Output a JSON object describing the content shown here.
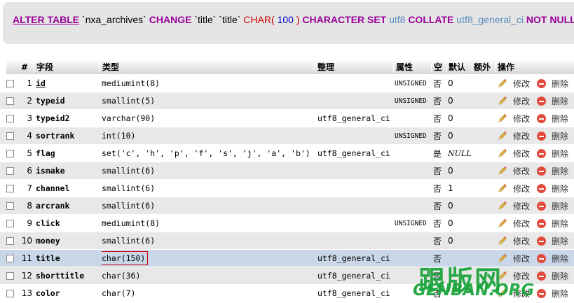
{
  "sql": {
    "alter_table": "ALTER TABLE",
    "table": "`nxa_archives`",
    "change": "CHANGE",
    "old_col": "`title`",
    "new_col": "`title`",
    "char_fn": "CHAR(",
    "length": "100",
    "paren_close": ")",
    "character_set": "CHARACTER SET",
    "charset": "utf8",
    "collate": "COLLATE",
    "collation": "utf8_general_ci",
    "not_null": "NOT NULL"
  },
  "headers": {
    "num": "#",
    "field": "字段",
    "type": "类型",
    "collation": "整理",
    "attributes": "属性",
    "null": "空",
    "default": "默认",
    "extra": "额外",
    "action": "操作"
  },
  "actions": {
    "edit": "修改",
    "delete": "删除"
  },
  "rows": [
    {
      "num": "1",
      "field": "id",
      "type": "mediumint(8)",
      "collation": "",
      "attr": "UNSIGNED",
      "null": "否",
      "default": "0"
    },
    {
      "num": "2",
      "field": "typeid",
      "type": "smallint(5)",
      "collation": "",
      "attr": "UNSIGNED",
      "null": "否",
      "default": "0"
    },
    {
      "num": "3",
      "field": "typeid2",
      "type": "varchar(90)",
      "collation": "utf8_general_ci",
      "attr": "",
      "null": "否",
      "default": "0"
    },
    {
      "num": "4",
      "field": "sortrank",
      "type": "int(10)",
      "collation": "",
      "attr": "UNSIGNED",
      "null": "否",
      "default": "0"
    },
    {
      "num": "5",
      "field": "flag",
      "type": "set('c', 'h', 'p', 'f', 's', 'j', 'a', 'b')",
      "collation": "utf8_general_ci",
      "attr": "",
      "null": "是",
      "default": "NULL"
    },
    {
      "num": "6",
      "field": "ismake",
      "type": "smallint(6)",
      "collation": "",
      "attr": "",
      "null": "否",
      "default": "0"
    },
    {
      "num": "7",
      "field": "channel",
      "type": "smallint(6)",
      "collation": "",
      "attr": "",
      "null": "否",
      "default": "1"
    },
    {
      "num": "8",
      "field": "arcrank",
      "type": "smallint(6)",
      "collation": "",
      "attr": "",
      "null": "否",
      "default": "0"
    },
    {
      "num": "9",
      "field": "click",
      "type": "mediumint(8)",
      "collation": "",
      "attr": "UNSIGNED",
      "null": "否",
      "default": "0"
    },
    {
      "num": "10",
      "field": "money",
      "type": "smallint(6)",
      "collation": "",
      "attr": "",
      "null": "否",
      "default": "0"
    },
    {
      "num": "11",
      "field": "title",
      "type": "char(150)",
      "collation": "utf8_general_ci",
      "attr": "",
      "null": "否",
      "default": ""
    },
    {
      "num": "12",
      "field": "shorttitle",
      "type": "char(36)",
      "collation": "utf8_general_ci",
      "attr": "",
      "null": "否",
      "default": ""
    },
    {
      "num": "13",
      "field": "color",
      "type": "char(7)",
      "collation": "utf8_general_ci",
      "attr": "",
      "null": "否",
      "default": ""
    }
  ],
  "watermark": {
    "cn": "跟版网",
    "en": "GENBAN.ORG"
  }
}
